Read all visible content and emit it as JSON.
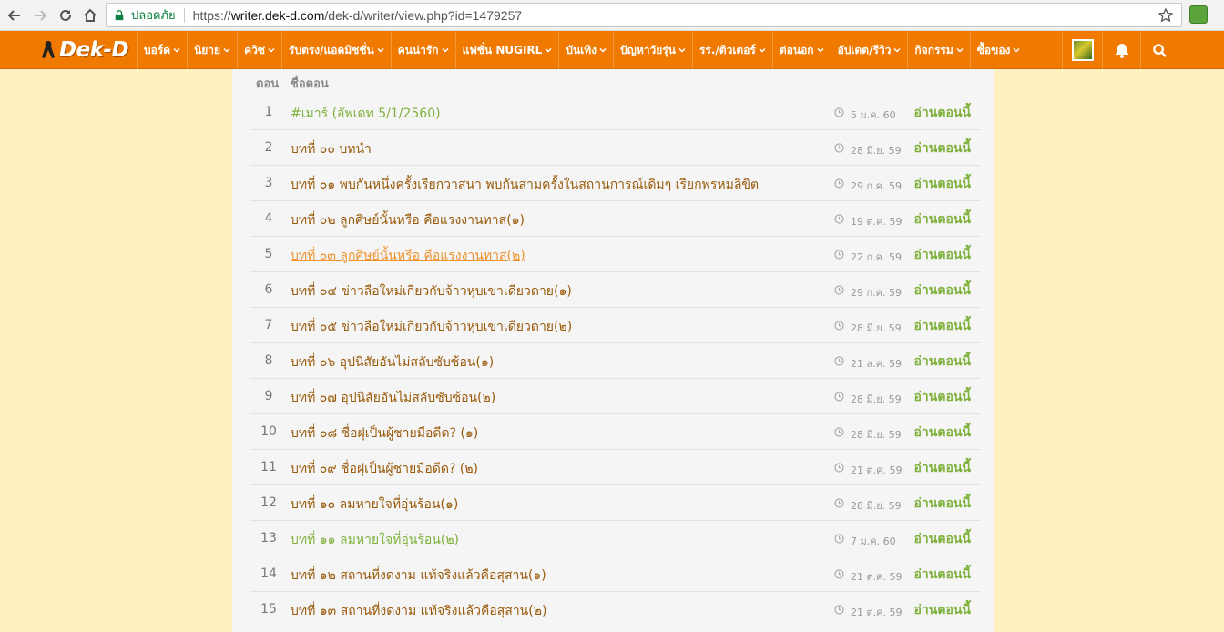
{
  "browser": {
    "secure_label": "ปลอดภัย",
    "url_scheme": "https://",
    "url_host": "writer.dek-d.com",
    "url_path": "/dek-d/writer/view.php?id=1479257"
  },
  "site": {
    "logo": "Dek-D",
    "menu": [
      "บอร์ด",
      "นิยาย",
      "ควิซ",
      "รับตรง/แอดมิชชั่น",
      "คนน่ารัก",
      "แฟชั่น NUGIRL",
      "บันเทิง",
      "ปัญหาวัยรุ่น",
      "รร./ติวเตอร์",
      "ต่อนอก",
      "อัปเดต/รีวิว",
      "กิจกรรม",
      "ซื้อของ"
    ]
  },
  "list": {
    "header_num": "ตอน",
    "header_title": "ชื่อตอน",
    "read_label": "อ่านตอนนี้",
    "rows": [
      {
        "num": "1",
        "title": "#เมาร์ (อัพเดท 5/1/2560)",
        "date": "5 ม.ค. 60",
        "style": "green"
      },
      {
        "num": "2",
        "title": "บทที่ ๐๐ บทนำ",
        "date": "28 มิ.ย. 59",
        "style": "normal"
      },
      {
        "num": "3",
        "title": "บทที่ ๐๑ พบกันหนึ่งครั้งเรียกวาสนา พบกันสามครั้งในสถานการณ์เดิมๆ เรียกพรหมลิขิต",
        "date": "29 ก.ค. 59",
        "style": "normal"
      },
      {
        "num": "4",
        "title": "บทที่ ๐๒ ลูกศิษย์นั้นหรือ คือแรงงานทาส(๑)",
        "date": "19 ต.ค. 59",
        "style": "normal"
      },
      {
        "num": "5",
        "title": "บทที่ ๐๓ ลูกศิษย์นั้นหรือ คือแรงงานทาส(๒)",
        "date": "22 ก.ค. 59",
        "style": "link"
      },
      {
        "num": "6",
        "title": "บทที่ ๐๔ ข่าวลือใหม่เกี่ยวกับจ้าวหุบเขาเดียวดาย(๑)",
        "date": "29 ก.ค. 59",
        "style": "normal"
      },
      {
        "num": "7",
        "title": "บทที่ ๐๕ ข่าวลือใหม่เกี่ยวกับจ้าวหุบเขาเดียวดาย(๒)",
        "date": "28 มิ.ย. 59",
        "style": "normal"
      },
      {
        "num": "8",
        "title": "บทที่ ๐๖ อุปนิสัยอันไม่สลับซับซ้อน(๑)",
        "date": "21 ส.ค. 59",
        "style": "normal"
      },
      {
        "num": "9",
        "title": "บทที่ ๐๗ อุปนิสัยอันไม่สลับซับซ้อน(๒)",
        "date": "28 มิ.ย. 59",
        "style": "normal"
      },
      {
        "num": "10",
        "title": "บทที่ ๐๘ ชื่อฝุเป็นผู้ชายมือดีด? (๑)",
        "date": "28 มิ.ย. 59",
        "style": "normal"
      },
      {
        "num": "11",
        "title": "บทที่ ๐๙ ชื่อฝุเป็นผู้ชายมือดีด? (๒)",
        "date": "21 ต.ค. 59",
        "style": "normal"
      },
      {
        "num": "12",
        "title": "บทที่ ๑๐ ลมหายใจที่อุ่นร้อน(๑)",
        "date": "28 มิ.ย. 59",
        "style": "normal"
      },
      {
        "num": "13",
        "title": "บทที่ ๑๑ ลมหายใจที่อุ่นร้อน(๒)",
        "date": "7 ม.ค. 60",
        "style": "green"
      },
      {
        "num": "14",
        "title": "บทที่ ๑๒ สถานที่งดงาม แท้จริงแล้วคือสุสาน(๑)",
        "date": "21 ต.ค. 59",
        "style": "normal"
      },
      {
        "num": "15",
        "title": "บทที่ ๑๓ สถานที่งดงาม แท้จริงแล้วคือสุสาน(๒)",
        "date": "21 ต.ค. 59",
        "style": "normal"
      }
    ]
  },
  "colors": {
    "nav_orange": "#f07a00",
    "page_bg": "#fff0c0",
    "title_brown": "#995a0a",
    "green": "#7fb13d",
    "link_orange": "#f0922e"
  }
}
